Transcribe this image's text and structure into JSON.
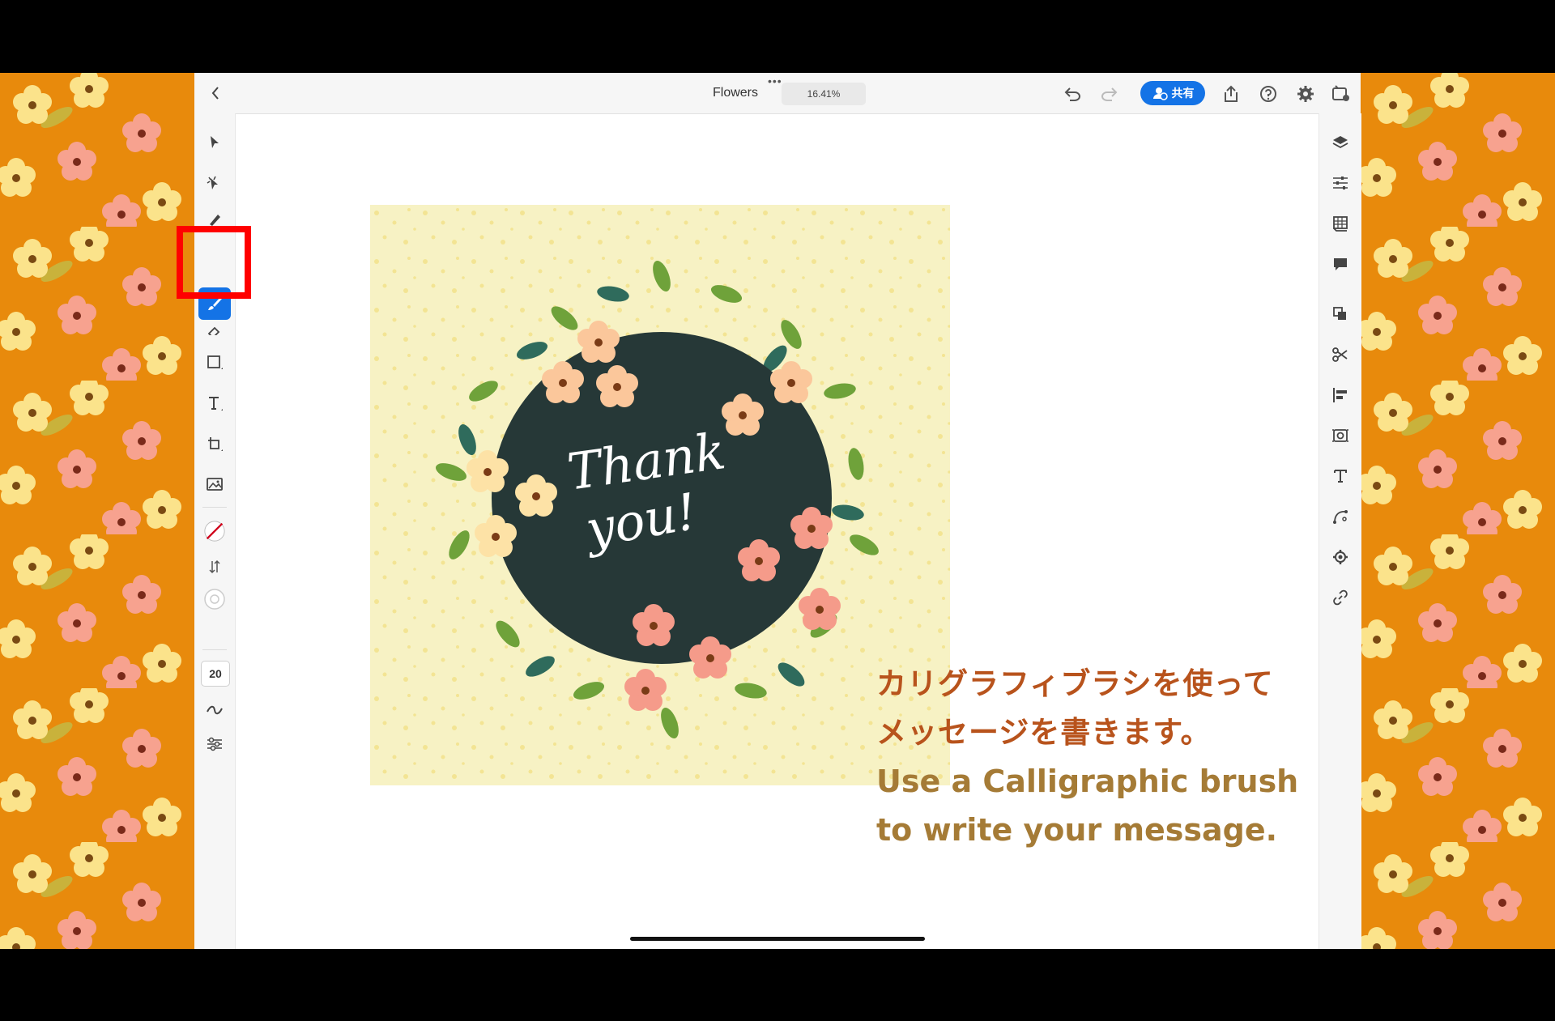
{
  "document": {
    "title": "Flowers",
    "zoom": "16.41%"
  },
  "topbar": {
    "share_label": "共有",
    "icons": [
      "back-icon",
      "more-icon",
      "undo-icon",
      "redo-icon",
      "export-icon",
      "help-icon",
      "settings-icon",
      "tour-icon"
    ]
  },
  "left_toolbar": {
    "tools": [
      "selection",
      "direct-selection",
      "pen",
      "paintbrush",
      "eraser",
      "rectangle",
      "type",
      "transform",
      "image-place",
      "fill-stroke",
      "swap-fill-stroke",
      "stroke-weight",
      "brush-size",
      "smoothing",
      "brush-settings"
    ],
    "brush_size": "20",
    "active_tool": "paintbrush"
  },
  "right_toolbar": {
    "tools": [
      "layers",
      "properties",
      "libraries",
      "comments",
      "arrange",
      "cut",
      "align",
      "repeat",
      "type-properties",
      "path",
      "object-settings",
      "link"
    ]
  },
  "artwork": {
    "handwritten_text_line1": "Thank",
    "handwritten_text_line2": "you!",
    "colors": {
      "artboard": "#f7f2c4",
      "circle": "#263837",
      "speckle": "#f0d96a"
    }
  },
  "caption": {
    "jp_line1": "カリグラフィブラシを使って",
    "jp_line2": "メッセージを書きます。",
    "en_line1": "Use a Calligraphic brush",
    "en_line2": "to write your message."
  },
  "colors": {
    "accent": "#1473e6",
    "highlight": "#ff0000",
    "background_pattern": "#e88a0c"
  }
}
